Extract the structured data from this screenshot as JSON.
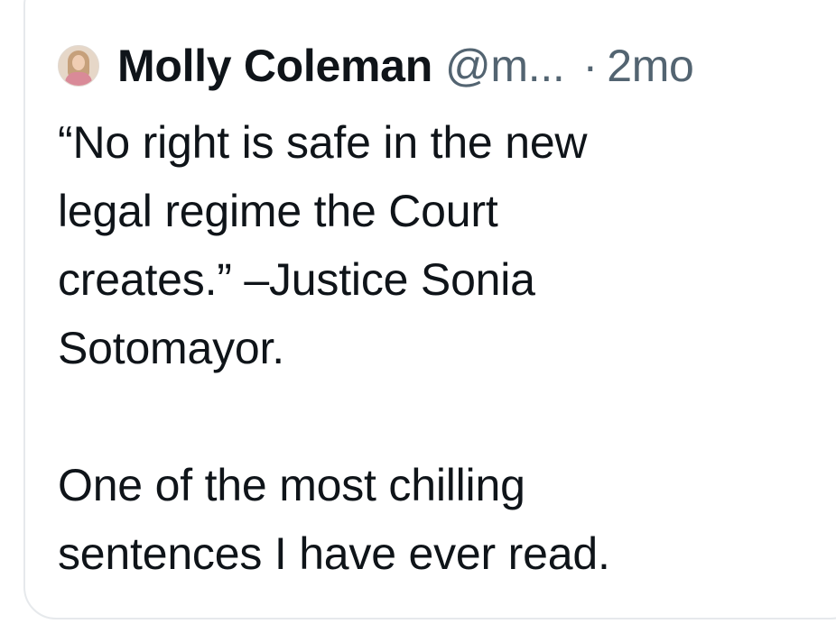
{
  "tweet": {
    "author_name": "Molly Coleman",
    "handle": "@m...",
    "separator": "·",
    "timestamp": "2mo",
    "avatar_icon": "profile-photo",
    "paragraph1_lines": [
      "“No right is safe in the new",
      "legal regime the Court",
      "creates.” –Justice Sonia",
      "Sotomayor."
    ],
    "paragraph2_lines": [
      "One of the most chilling",
      "sentences I have ever read."
    ]
  },
  "colors": {
    "text_primary": "#0f1419",
    "text_secondary": "#536471",
    "border": "#e6e9ec"
  }
}
